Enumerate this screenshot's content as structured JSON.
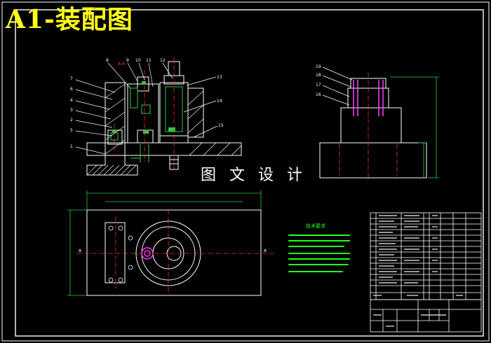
{
  "header": {
    "title": "A1-装配图"
  },
  "watermark": {
    "text": "图 文 设 计"
  },
  "colors": {
    "background": "#000000",
    "frame": "#ffffff",
    "title": "#ffff1a",
    "outline": "#ffffff",
    "dimension": "#2ecc40",
    "centerline": "#ff3030",
    "leader": "#ffffff",
    "highlight": "#ff40ff",
    "notes": "#22ff22"
  },
  "section_view": {
    "label": "A-A",
    "part_numbers_left": [
      "7",
      "6",
      "4",
      "3",
      "2",
      "5",
      "1"
    ],
    "part_numbers_top": [
      "8",
      "9",
      "10",
      "11",
      "12"
    ],
    "part_numbers_right": [
      "13",
      "14",
      "15"
    ]
  },
  "side_view": {
    "part_numbers": [
      "19",
      "18",
      "17",
      "16"
    ]
  },
  "plan_view": {
    "section_marks": [
      "A",
      "A"
    ]
  },
  "notes_title": "技术要求",
  "icons": [
    "drawing-frame-icon",
    "parts-list-icon"
  ]
}
